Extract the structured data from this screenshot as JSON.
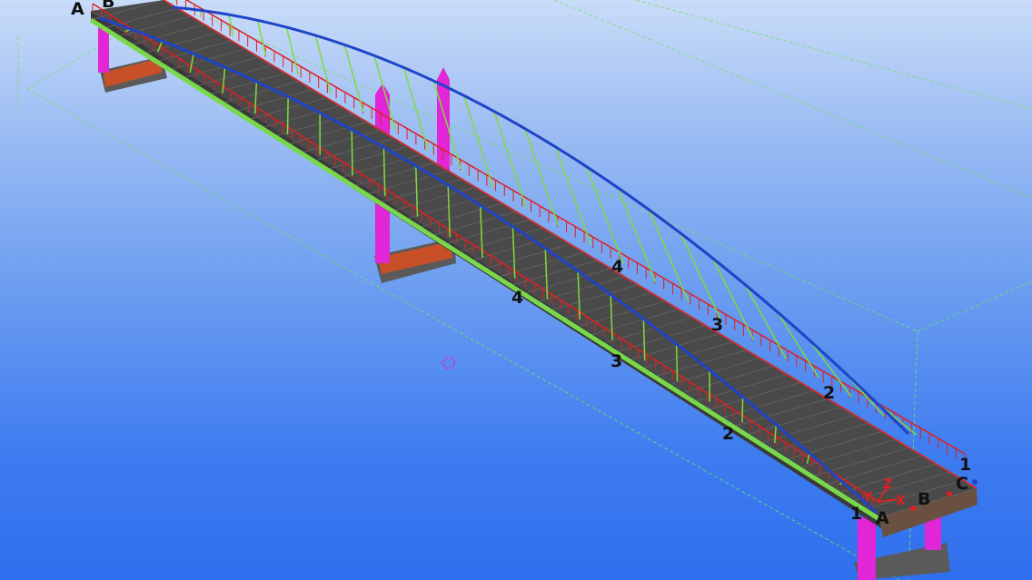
{
  "viewport": {
    "description_colors": {
      "background_top": "#c9dcf8",
      "background_bottom": "#2f6fee",
      "deck": "#4a4a4a",
      "railing": "#e02020",
      "arch": "#1e44c8",
      "hangers": "#7ddc3a",
      "piers": "#e026d6",
      "guides": "#6fe06f"
    }
  },
  "grid_labels": {
    "top_A": "A",
    "top_B": "B",
    "bottom_A": "A",
    "bottom_B": "B",
    "bottom_C": "C",
    "bottom_1_right": "1",
    "bottom_1_left": "1",
    "right_4": "4",
    "right_3": "3",
    "right_2": "2",
    "left_4": "4",
    "left_3": "3",
    "left_2": "2"
  },
  "axes": {
    "x": "X",
    "y": "Y",
    "z": "Z"
  },
  "icons": {
    "target": "rotation-center-icon"
  }
}
